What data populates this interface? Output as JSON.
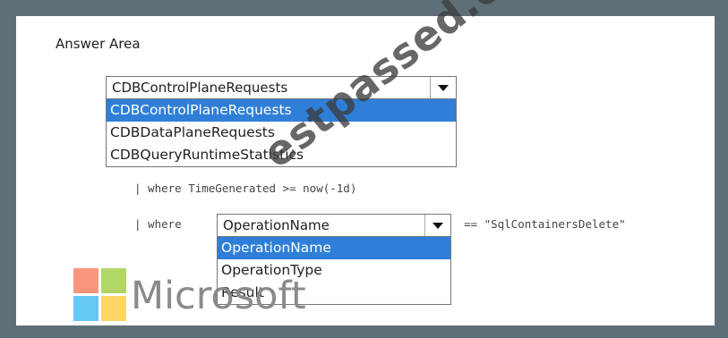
{
  "answer_area": {
    "title": "Answer Area"
  },
  "dropdown_table": {
    "selected": "CDBControlPlaneRequests",
    "options": [
      "CDBControlPlaneRequests",
      "CDBDataPlaneRequests",
      "CDBQueryRuntimeStatistics"
    ],
    "highlighted_index": 0,
    "arrow_icon": "triangle-down-icon"
  },
  "code": {
    "line1": "| where TimeGenerated >= now(-1d)",
    "line2_prefix": "| where",
    "line2_suffix": "== \"SqlContainersDelete\""
  },
  "dropdown_field": {
    "selected": "OperationName",
    "options": [
      "OperationName",
      "OperationType",
      "Result"
    ],
    "highlighted_index": 0,
    "arrow_icon": "triangle-down-icon"
  },
  "watermark": {
    "text": "estpassed.com"
  },
  "logo": {
    "wordmark": "Microsoft",
    "colors": {
      "red": "#f25022",
      "green": "#7fba00",
      "blue": "#00a4ef",
      "yellow": "#ffb900"
    }
  },
  "colors": {
    "highlight": "#2f7fd8",
    "frame": "#5f6f78"
  }
}
